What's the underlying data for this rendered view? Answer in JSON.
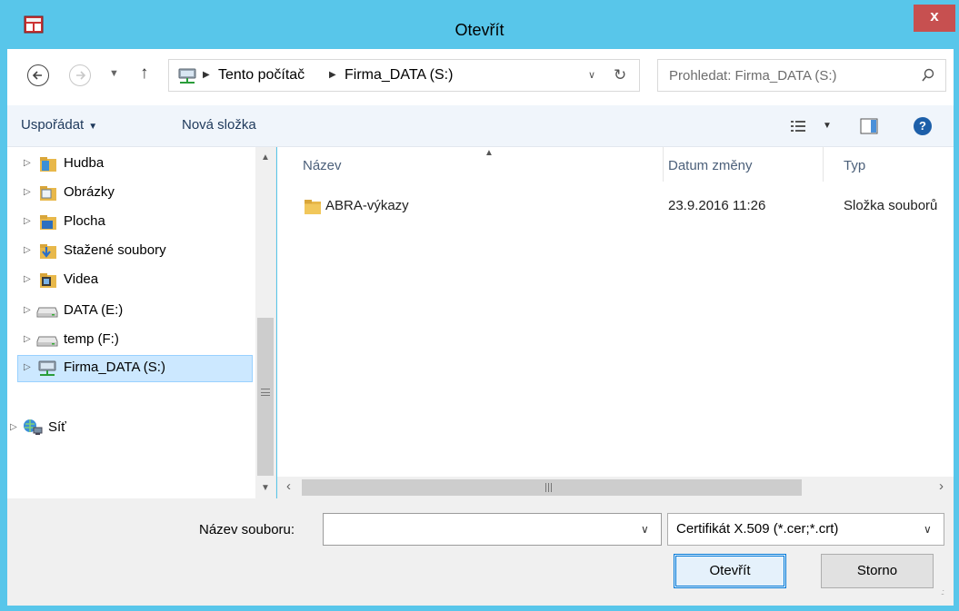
{
  "window": {
    "title": "Otevřít",
    "close_label": "x"
  },
  "address_bar": {
    "crumbs": [
      "Tento počítač",
      "Firma_DATA (S:)"
    ]
  },
  "search": {
    "placeholder": "Prohledat: Firma_DATA (S:)"
  },
  "toolbar": {
    "organize_label": "Uspořádat",
    "new_folder_label": "Nová složka"
  },
  "nav_tree": [
    {
      "label": "Hudba",
      "icon": "music-folder-icon"
    },
    {
      "label": "Obrázky",
      "icon": "pictures-folder-icon"
    },
    {
      "label": "Plocha",
      "icon": "desktop-folder-icon"
    },
    {
      "label": "Stažené soubory",
      "icon": "downloads-folder-icon"
    },
    {
      "label": "Videa",
      "icon": "videos-folder-icon"
    },
    {
      "label": "DATA (E:)",
      "icon": "drive-icon"
    },
    {
      "label": "temp (F:)",
      "icon": "drive-icon"
    },
    {
      "label": "Firma_DATA (S:)",
      "icon": "network-drive-icon",
      "selected": true
    },
    {
      "label": "Síť",
      "icon": "network-icon"
    }
  ],
  "file_list": {
    "columns": [
      "Název",
      "Datum změny",
      "Typ"
    ],
    "rows": [
      {
        "name": "ABRA-výkazy",
        "modified": "23.9.2016 11:26",
        "type": "Složka souborů"
      }
    ]
  },
  "bottom": {
    "filename_label": "Název souboru:",
    "filename_value": "",
    "filter_value": "Certifikát X.509 (*.cer;*.crt)",
    "open_label": "Otevřít",
    "cancel_label": "Storno"
  },
  "colors": {
    "titlebar": "#58c6ea",
    "close_button": "#c75050",
    "selection": "#cce8ff",
    "folder": "#e8b84a"
  }
}
